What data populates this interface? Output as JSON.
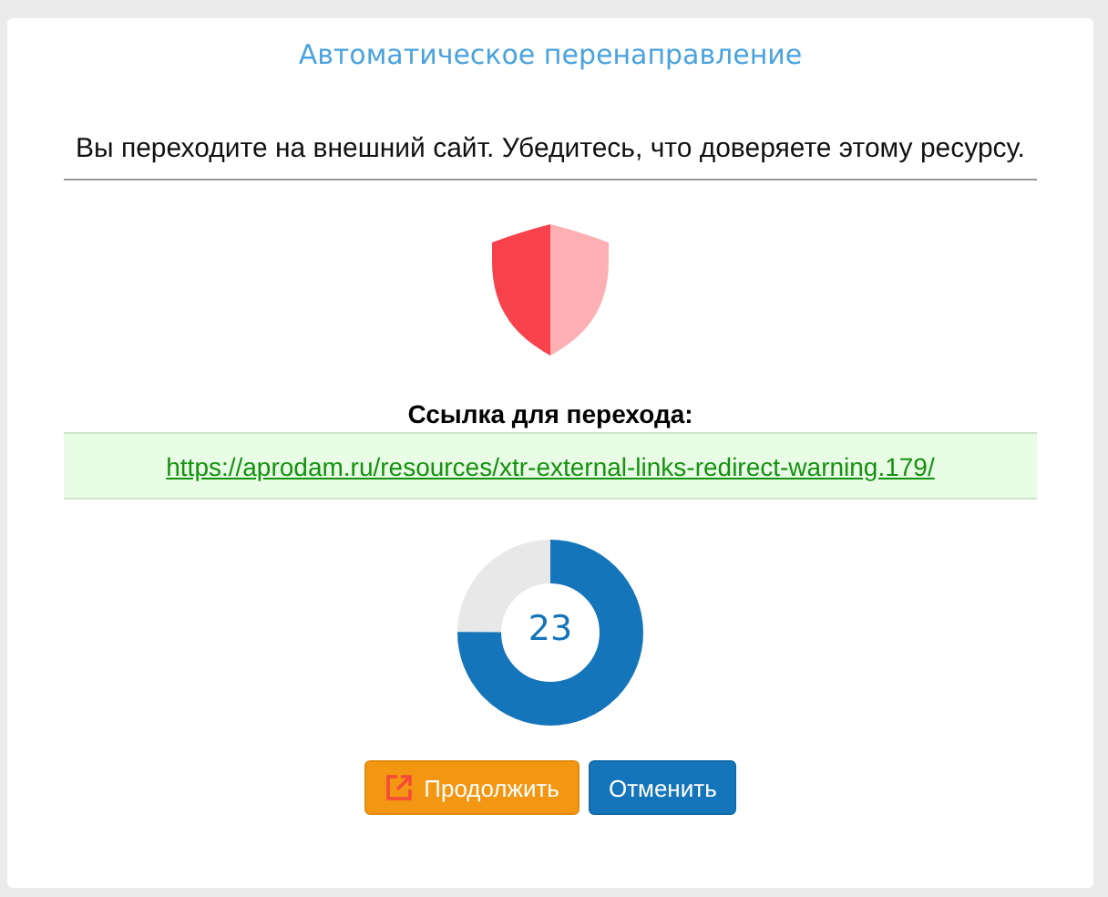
{
  "dialog": {
    "title": "Автоматическое перенаправление",
    "message": "Вы переходите на внешний сайт. Убедитесь, что доверяете этому ресурсу.",
    "link_label": "Ссылка для перехода:",
    "link": "https://aprodam.ru/resources/xtr-external-links-redirect-warning.179/",
    "countdown": {
      "value": "23",
      "level": 0.75
    },
    "buttons": [
      {
        "kind": "continue",
        "label": "Продолжить"
      },
      {
        "kind": "cancel",
        "label": "Отменить"
      }
    ]
  }
}
